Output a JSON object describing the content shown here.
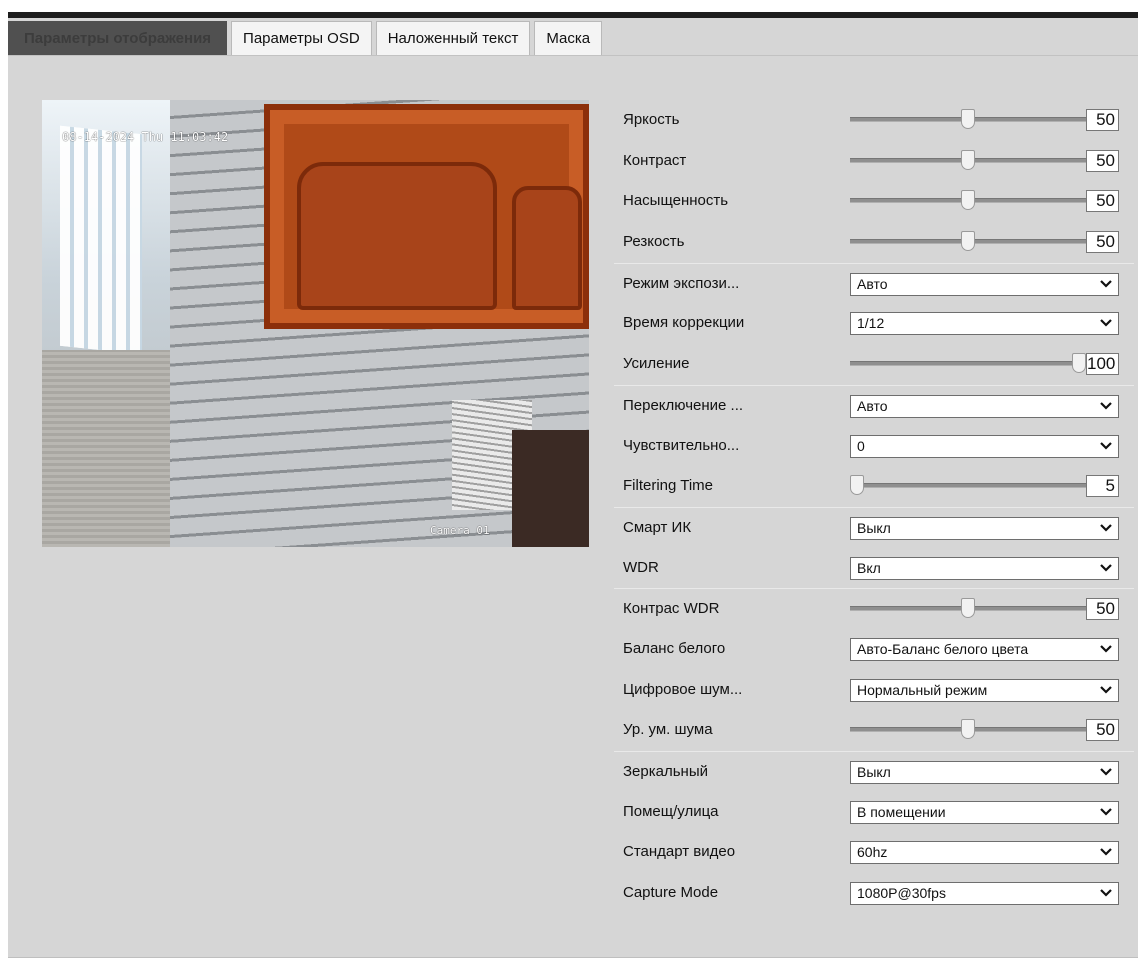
{
  "tabs": [
    {
      "label": "Параметры отображения",
      "active": true
    },
    {
      "label": "Параметры OSD",
      "active": false
    },
    {
      "label": "Наложенный текст",
      "active": false
    },
    {
      "label": "Маска",
      "active": false
    }
  ],
  "preview": {
    "timestamp": "08-14-2024 Thu 11:03:42",
    "camera_label": "Camera 01"
  },
  "settings": [
    {
      "label": "Яркость",
      "type": "slider",
      "value": "50",
      "fraction": 0.5
    },
    {
      "label": "Контраст",
      "type": "slider",
      "value": "50",
      "fraction": 0.5
    },
    {
      "label": "Насыщенность",
      "type": "slider",
      "value": "50",
      "fraction": 0.5
    },
    {
      "label": "Резкость",
      "type": "slider",
      "value": "50",
      "fraction": 0.5
    },
    {
      "label": "Режим экспози...",
      "type": "select",
      "value": "Авто"
    },
    {
      "label": "Время коррекции",
      "type": "select",
      "value": "1/12"
    },
    {
      "label": "Усиление",
      "type": "slider",
      "value": "100",
      "fraction": 1.0
    },
    {
      "label": "Переключение ...",
      "type": "select",
      "value": "Авто"
    },
    {
      "label": "Чувствительно...",
      "type": "select",
      "value": "0"
    },
    {
      "label": "Filtering Time",
      "type": "slider",
      "value": "5",
      "fraction": 0.0
    },
    {
      "label": "Смарт ИК",
      "type": "select",
      "value": "Выкл"
    },
    {
      "label": "WDR",
      "type": "select",
      "value": "Вкл"
    },
    {
      "label": "Контрас WDR",
      "type": "slider",
      "value": "50",
      "fraction": 0.5
    },
    {
      "label": "Баланс белого",
      "type": "select",
      "value": "Авто-Баланс белого цвета"
    },
    {
      "label": "Цифровое шум...",
      "type": "select",
      "value": "Нормальный режим"
    },
    {
      "label": "Ур. ум. шума",
      "type": "slider",
      "value": "50",
      "fraction": 0.5
    },
    {
      "label": "Зеркальный",
      "type": "select",
      "value": "Выкл"
    },
    {
      "label": "Помещ/улица",
      "type": "select",
      "value": "В помещении"
    },
    {
      "label": "Стандарт видео",
      "type": "select",
      "value": "60hz"
    },
    {
      "label": "Capture Mode",
      "type": "select",
      "value": "1080P@30fps"
    }
  ],
  "separators_before": [
    4,
    7,
    10,
    12,
    16
  ]
}
